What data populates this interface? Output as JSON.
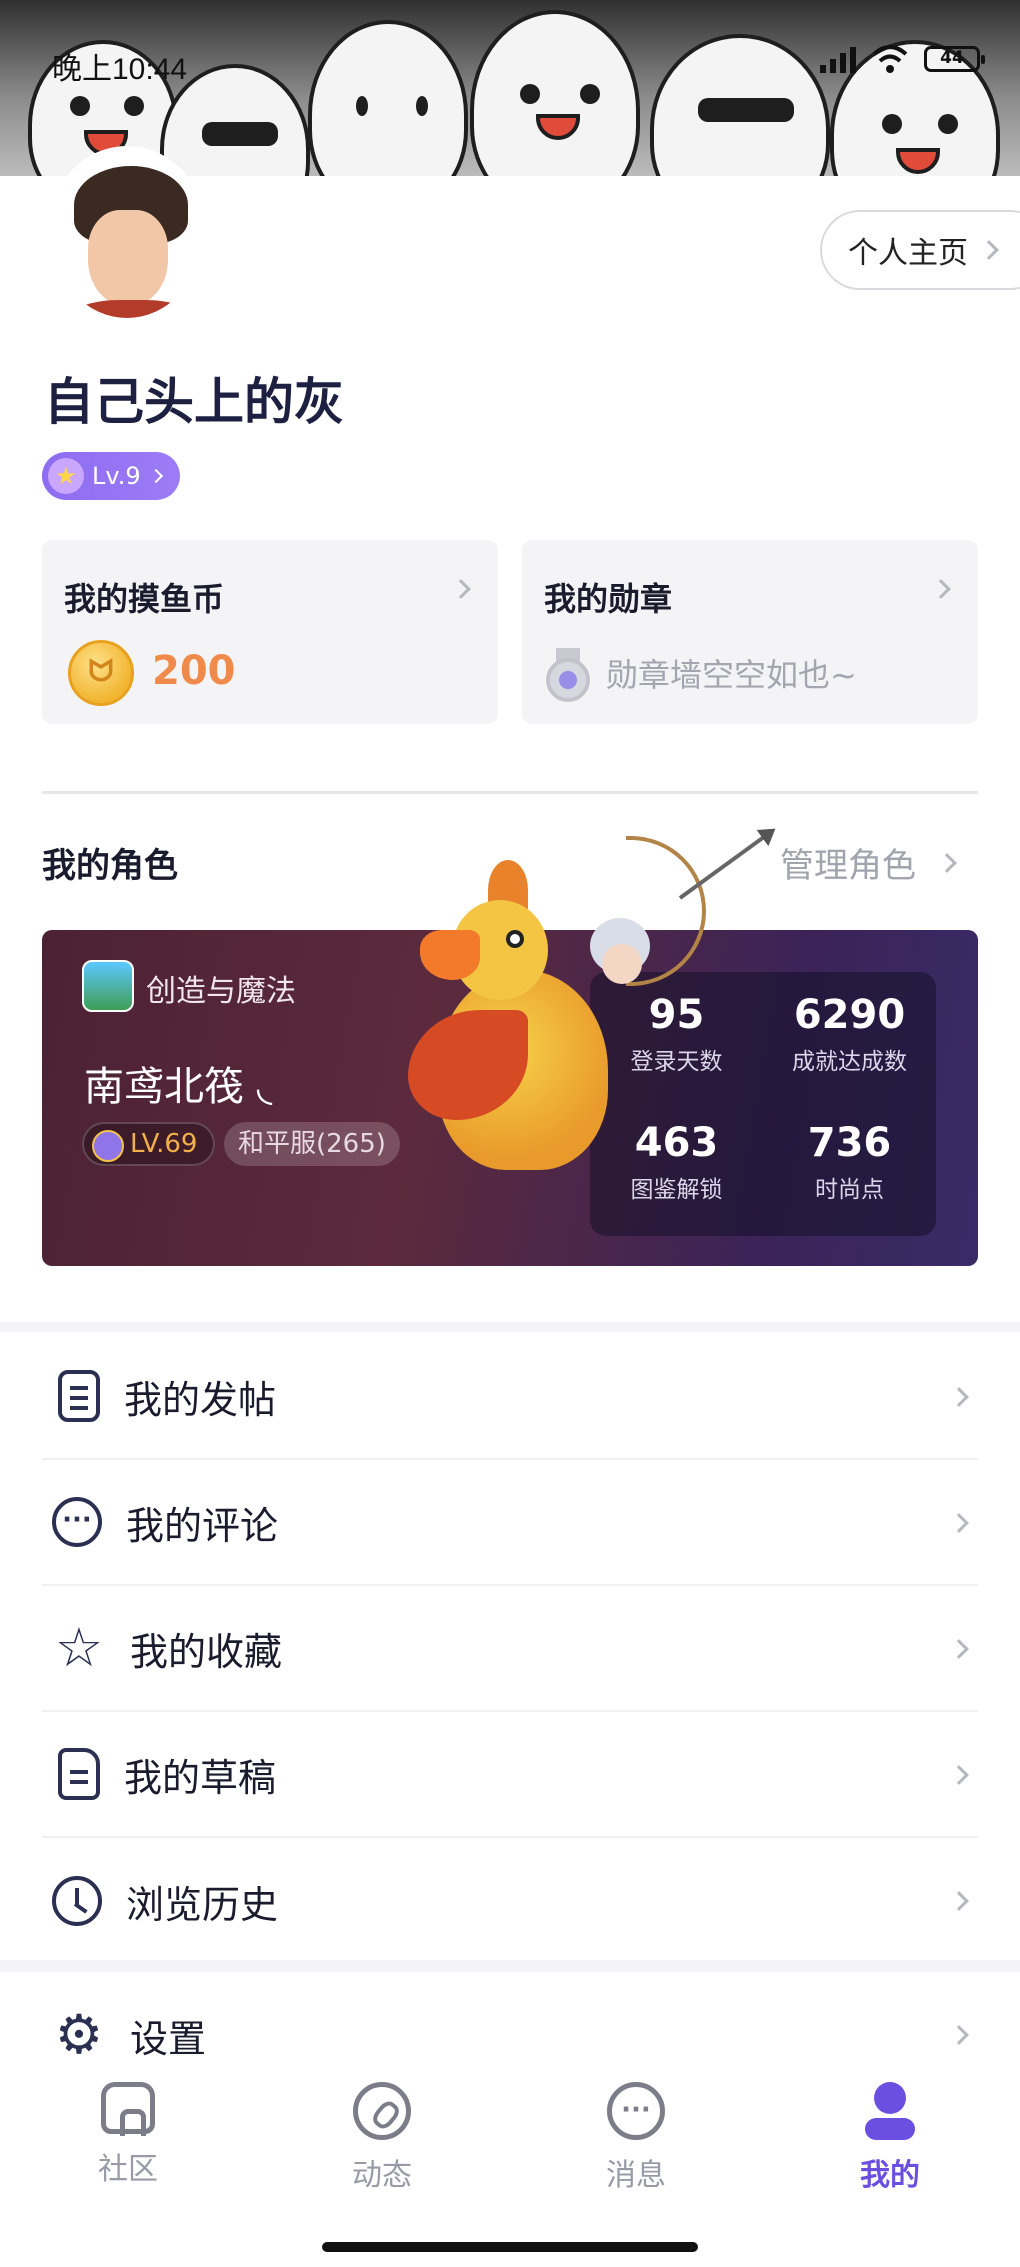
{
  "status_bar": {
    "time": "晚上10:44",
    "battery": "44"
  },
  "profile": {
    "homepage_button": "个人主页",
    "username": "自己头上的灰",
    "level": "Lv.9"
  },
  "cards": {
    "coins": {
      "title": "我的摸鱼币",
      "value": "200"
    },
    "medals": {
      "title": "我的勋章",
      "empty_text": "勋章墙空空如也~"
    }
  },
  "roles": {
    "section_title": "我的角色",
    "manage_label": "管理角色",
    "card": {
      "game_name": "创造与魔法",
      "role_name": "南鸢北筏 ◟",
      "level": "LV.69",
      "server": "和平服(265)",
      "stats": [
        {
          "value": "95",
          "label": "登录天数"
        },
        {
          "value": "6290",
          "label": "成就达成数"
        },
        {
          "value": "463",
          "label": "图鉴解锁"
        },
        {
          "value": "736",
          "label": "时尚点"
        }
      ]
    }
  },
  "menu": [
    {
      "label": "我的发帖",
      "icon": "post-icon"
    },
    {
      "label": "我的评论",
      "icon": "comment-icon"
    },
    {
      "label": "我的收藏",
      "icon": "star-icon"
    },
    {
      "label": "我的草稿",
      "icon": "draft-icon"
    },
    {
      "label": "浏览历史",
      "icon": "clock-icon"
    },
    {
      "label": "设置",
      "icon": "gear-icon"
    }
  ],
  "tabbar": {
    "active": "我的",
    "items": [
      {
        "label": "社区",
        "icon": "home-icon"
      },
      {
        "label": "动态",
        "icon": "compass-icon"
      },
      {
        "label": "消息",
        "icon": "message-icon"
      },
      {
        "label": "我的",
        "icon": "profile-icon"
      }
    ]
  },
  "colors": {
    "accent": "#6a4fe0",
    "coin": "#ef8a4a",
    "level_badge": "#8d6df0"
  }
}
